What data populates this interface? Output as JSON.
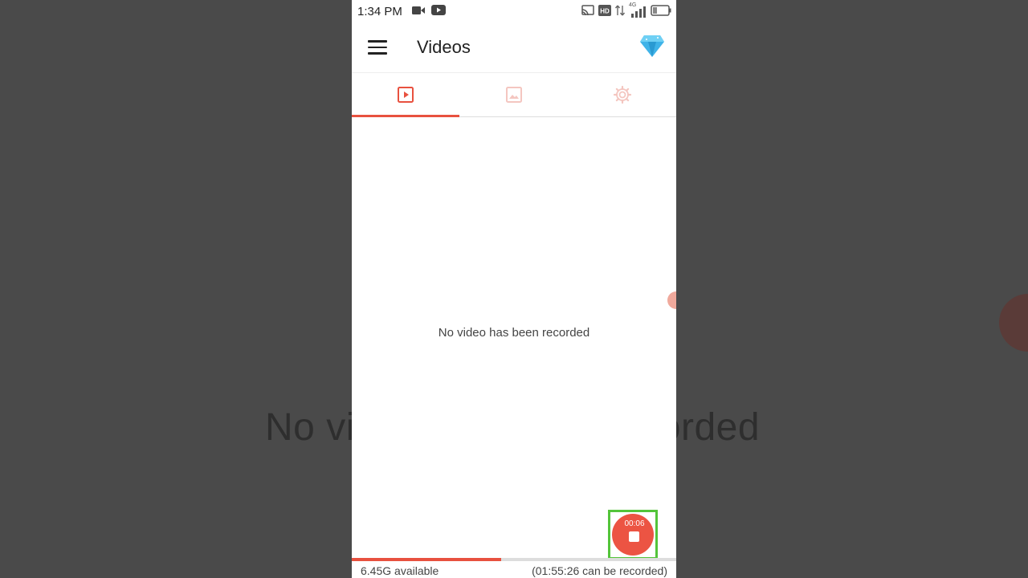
{
  "status_bar": {
    "time": "1:34 PM",
    "network": "4G",
    "hd": "HD"
  },
  "app_bar": {
    "title": "Videos"
  },
  "tabs": [
    {
      "name": "videos",
      "icon": "play-square-icon",
      "selected": true
    },
    {
      "name": "screenshots",
      "icon": "image-icon",
      "selected": false
    },
    {
      "name": "settings",
      "icon": "gear-icon",
      "selected": false
    }
  ],
  "main": {
    "empty_message": "No video has been recorded"
  },
  "background": {
    "echo_text": "No video has been recorded"
  },
  "recording": {
    "elapsed": "00:06"
  },
  "storage": {
    "available": "6.45G available",
    "remaining": "(01:55:26 can be recorded)",
    "used_fraction": 0.46
  },
  "colors": {
    "accent": "#e8513f",
    "fab": "#ec5443",
    "highlight": "#53c43a"
  }
}
